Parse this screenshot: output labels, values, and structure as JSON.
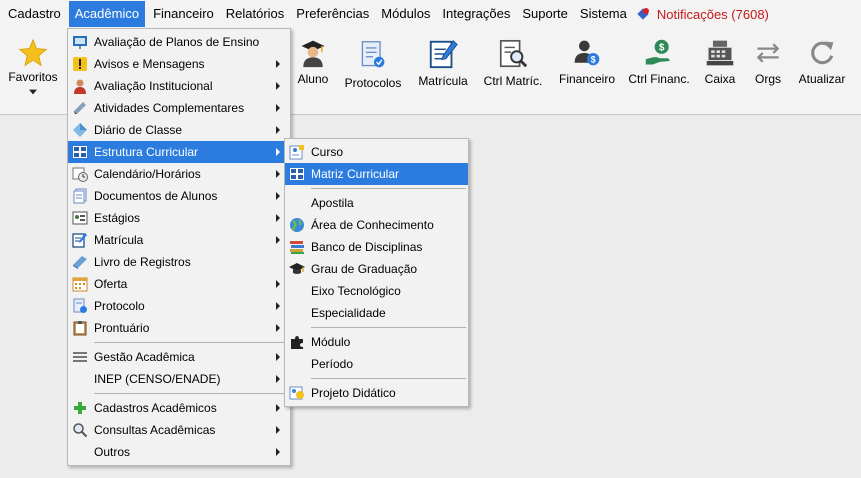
{
  "menubar": {
    "items": [
      "Cadastro",
      "Acadêmico",
      "Financeiro",
      "Relatórios",
      "Preferências",
      "Módulos",
      "Integrações",
      "Suporte",
      "Sistema"
    ],
    "notifications": "Notificações (7608)"
  },
  "toolbar": {
    "favoritos": "Favoritos",
    "aluno": "Aluno",
    "protocolos": "Protocolos",
    "matricula": "Matrícula",
    "ctrl_matric": "Ctrl Matríc.",
    "financeiro": "Financeiro",
    "ctrl_financ": "Ctrl Financ.",
    "caixa": "Caixa",
    "orgs": "Orgs",
    "atualizar": "Atualizar"
  },
  "menu_academico": {
    "items": [
      "Avaliação de Planos de Ensino",
      "Avisos e Mensagens",
      "Avaliação Institucional",
      "Atividades Complementares",
      "Diário de Classe",
      "Estrutura Curricular",
      "Calendário/Horários",
      "Documentos de Alunos",
      "Estágios",
      "Matrícula",
      "Livro de Registros",
      "Oferta",
      "Protocolo",
      "Prontuário",
      "Gestão Acadêmica",
      "INEP (CENSO/ENADE)",
      "Cadastros Acadêmicos",
      "Consultas Acadêmicas",
      "Outros"
    ]
  },
  "menu_estrutura": {
    "items": [
      "Curso",
      "Matriz Curricular",
      "Apostila",
      "Área de Conhecimento",
      "Banco de Disciplinas",
      "Grau de Graduação",
      "Eixo Tecnológico",
      "Especialidade",
      "Módulo",
      "Período",
      "Projeto Didático"
    ]
  },
  "colors": {
    "highlight": "#2c7cdf",
    "notification": "#c41a1a"
  }
}
